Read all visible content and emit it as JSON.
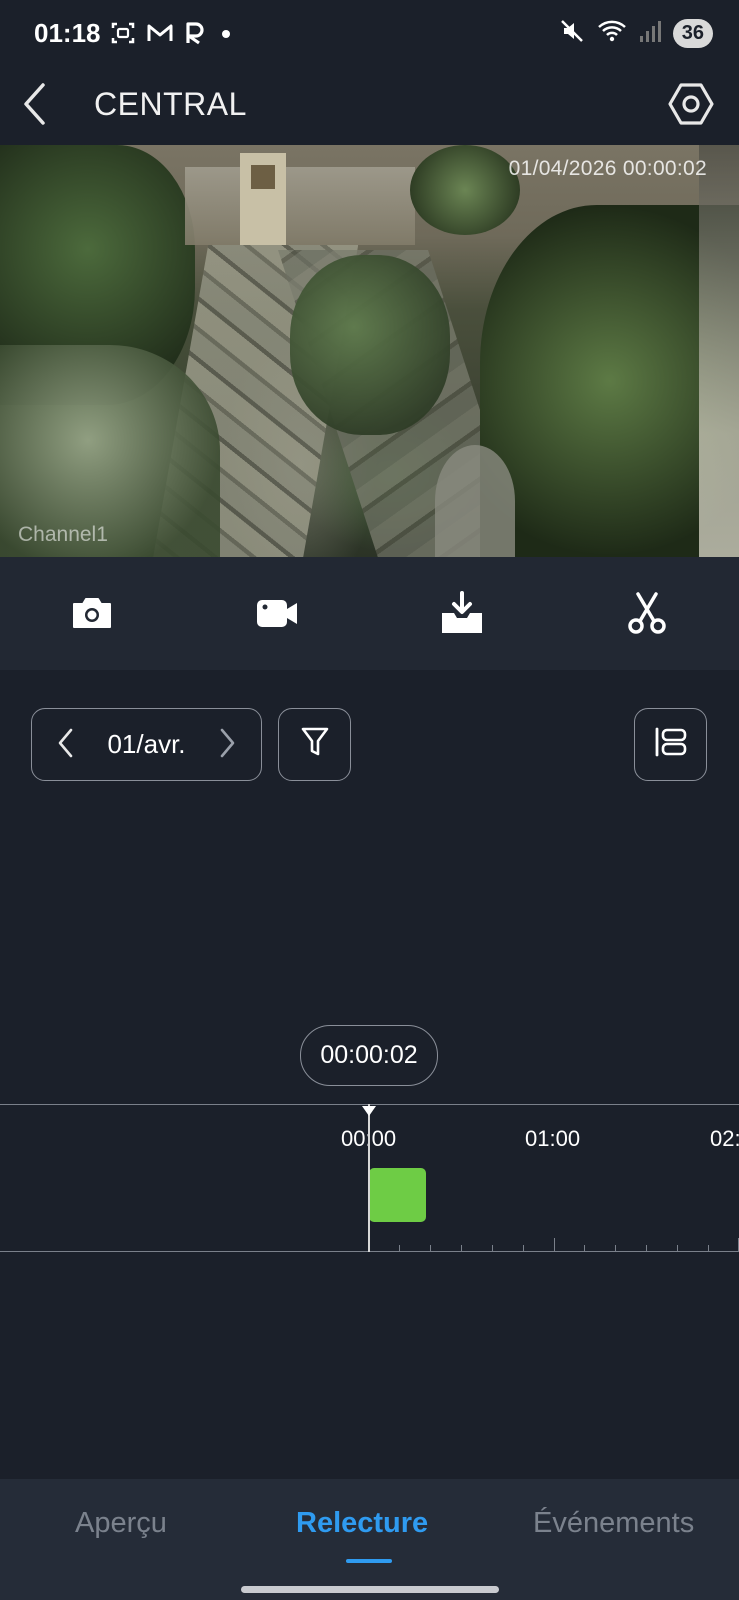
{
  "status_bar": {
    "time": "01:18",
    "battery": "36",
    "icons": [
      "screenshot-icon",
      "gmail-icon",
      "r-app-icon",
      "notification-dot-icon",
      "mute-icon",
      "wifi-icon",
      "signal-icon"
    ]
  },
  "header": {
    "title": "CENTRAL",
    "back_icon": "chevron-left-icon",
    "settings_icon": "hexagon-gear-icon"
  },
  "video": {
    "timestamp": "01/04/2026 00:00:02",
    "channel": "Channel1"
  },
  "toolbar": {
    "items": [
      {
        "icon": "camera-icon",
        "action": "snapshot"
      },
      {
        "icon": "video-record-icon",
        "action": "record"
      },
      {
        "icon": "download-icon",
        "action": "download"
      },
      {
        "icon": "scissors-icon",
        "action": "clip"
      }
    ]
  },
  "controls": {
    "date": "01/avr.",
    "filter_icon": "filter-icon",
    "layout_icon": "layout-icon"
  },
  "timeline": {
    "current_time": "00:00:02",
    "labels": [
      "00:00",
      "01:00",
      "02:"
    ],
    "recording_color": "#6ecc45"
  },
  "bottom_nav": {
    "tabs": [
      {
        "label": "Aperçu",
        "active": false
      },
      {
        "label": "Relecture",
        "active": true
      },
      {
        "label": "Événements",
        "active": false
      }
    ],
    "active_color": "#2f9bf0",
    "inactive_color": "#7b828d"
  }
}
